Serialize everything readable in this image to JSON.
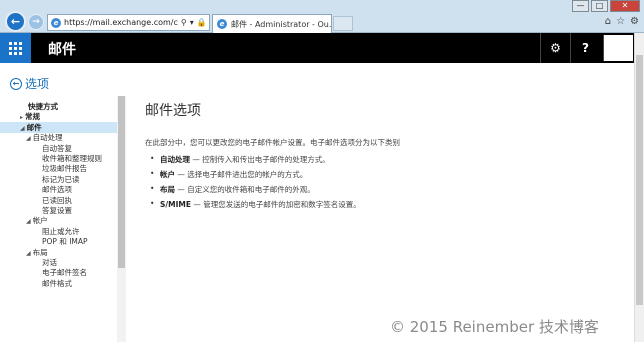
{
  "browser": {
    "address_url": "https://mail.exchange.com/c",
    "tab_title": "邮件 - Administrator - Ou...",
    "tab_close": "×",
    "window_buttons": [
      "—",
      "□",
      "✕"
    ],
    "toolbar_icons": [
      "home-icon",
      "star-icon",
      "gear-icon"
    ]
  },
  "owa": {
    "app_title": "邮件",
    "settings_glyph": "⚙",
    "help_glyph": "?"
  },
  "back_link": {
    "label": "选项",
    "glyph": "←"
  },
  "sidebar": {
    "items": [
      {
        "label": "快捷方式",
        "level": 0,
        "bold": true,
        "caret": ""
      },
      {
        "label": "常规",
        "level": 0,
        "bold": true,
        "caret": "▸"
      },
      {
        "label": "邮件",
        "level": 0,
        "bold": true,
        "caret": "◢",
        "selected": true
      },
      {
        "label": "自动处理",
        "level": 1,
        "caret": "◢"
      },
      {
        "label": "自动答复",
        "level": 2
      },
      {
        "label": "收件箱和整理规则",
        "level": 2
      },
      {
        "label": "垃圾邮件报告",
        "level": 2
      },
      {
        "label": "标记为已读",
        "level": 2
      },
      {
        "label": "邮件选项",
        "level": 2
      },
      {
        "label": "已读回执",
        "level": 2
      },
      {
        "label": "答复设置",
        "level": 2
      },
      {
        "label": "帐户",
        "level": 1,
        "caret": "◢"
      },
      {
        "label": "阻止或允许",
        "level": 2
      },
      {
        "label": "POP 和 IMAP",
        "level": 2
      },
      {
        "label": "布局",
        "level": 1,
        "caret": "◢"
      },
      {
        "label": "对话",
        "level": 2
      },
      {
        "label": "电子邮件签名",
        "level": 2
      },
      {
        "label": "邮件格式",
        "level": 2
      }
    ]
  },
  "main": {
    "title": "邮件选项",
    "intro": "在此部分中，您可以更改您的电子邮件帐户设置。电子邮件选项分为以下类别",
    "bullets": [
      {
        "term": "自动处理",
        "desc": " — 控制传入和传出电子邮件的处理方式。"
      },
      {
        "term": "帐户",
        "desc": " — 选择电子邮件进出您的帐户的方式。"
      },
      {
        "term": "布局",
        "desc": " — 自定义您的收件箱和电子邮件的外观。"
      },
      {
        "term": "S/MIME",
        "desc": " — 管理您发送的电子邮件的加密和数字签名设置。"
      }
    ]
  },
  "watermark": "© 2015 Reinember 技术博客"
}
